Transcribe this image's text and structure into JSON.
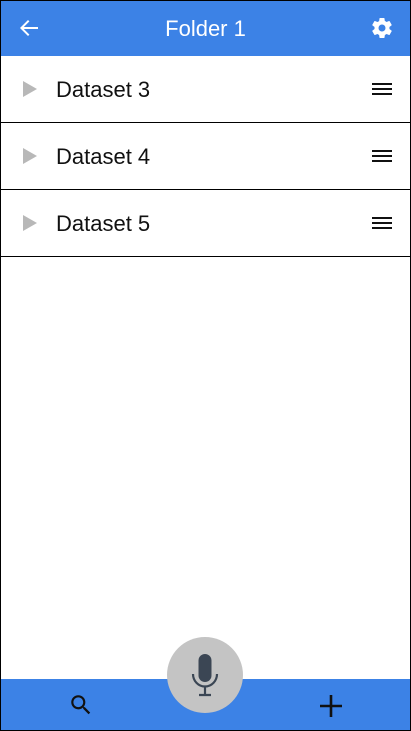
{
  "header": {
    "title": "Folder 1",
    "back_icon": "arrow-left-icon",
    "settings_icon": "gear-icon"
  },
  "datasets": [
    {
      "label": "Dataset 3",
      "expand_icon": "play-triangle-icon",
      "menu_icon": "hamburger-icon"
    },
    {
      "label": "Dataset 4",
      "expand_icon": "play-triangle-icon",
      "menu_icon": "hamburger-icon"
    },
    {
      "label": "Dataset 5",
      "expand_icon": "play-triangle-icon",
      "menu_icon": "hamburger-icon"
    }
  ],
  "bottom_bar": {
    "search_icon": "search-icon",
    "mic_icon": "microphone-icon",
    "add_icon": "plus-icon"
  },
  "colors": {
    "accent": "#3c82e6",
    "mic_button": "#c4c4c4",
    "expand_icon": "#b8b8b8"
  }
}
